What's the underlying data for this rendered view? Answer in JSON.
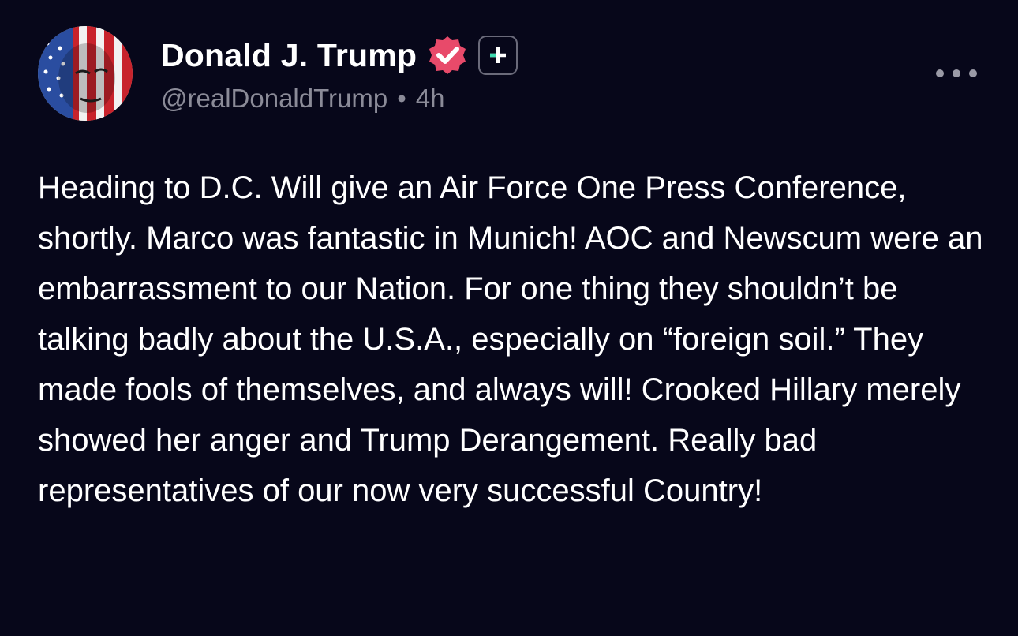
{
  "author": {
    "display_name": "Donald J. Trump",
    "handle": "@realDonaldTrump",
    "separator": "•",
    "time_ago": "4h"
  },
  "icons": {
    "avatar": "avatar-flag-portrait",
    "verified": "verified-badge-icon",
    "plus": "plus-badge-icon",
    "more": "more-options-icon"
  },
  "colors": {
    "background": "#07071a",
    "verified": "#e84a6a",
    "plus_badge": "#3ddbb0",
    "meta_text": "#8b8b98"
  },
  "post": {
    "text": "Heading to D.C. Will give an Air Force One Press Conference, shortly. Marco was fantastic in Munich! AOC and Newscum were an embarrassment to our Nation. For one thing they shouldn’t be talking badly about the U.S.A., especially on “foreign soil.” They made fools of themselves, and always will! Crooked Hillary merely showed her anger and Trump Derangement. Really bad representatives of our now very successful Country!"
  }
}
